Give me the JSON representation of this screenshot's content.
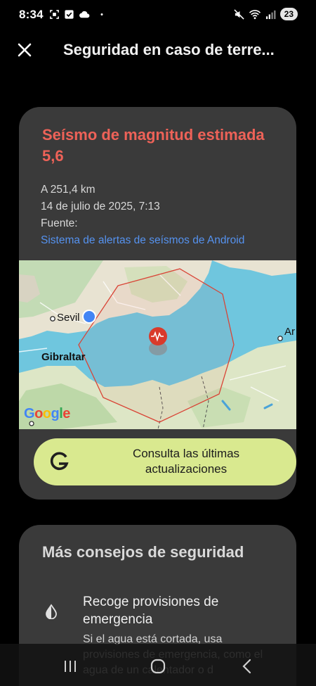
{
  "status_bar": {
    "time": "8:34",
    "battery": "23",
    "left_icons": [
      "screenshot-icon",
      "checkbox-icon",
      "cloud-icon",
      "dot-icon"
    ],
    "right_icons": [
      "mute-icon",
      "wifi-icon",
      "signal-icon"
    ]
  },
  "app_bar": {
    "title": "Seguridad en caso de terre..."
  },
  "quake_card": {
    "title": "Seísmo de magnitud estimada 5,6",
    "distance": "A 251,4 km",
    "datetime": "14 de julio de 2025, 7:13",
    "source_label": "Fuente:",
    "source_link": "Sistema de alertas de seísmos de Android",
    "colors": {
      "title": "#ee6258",
      "link": "#5592ef",
      "button": "#d9e98f"
    },
    "map": {
      "labels": {
        "sevilla": "Sevil",
        "gibraltar": "Gibraltar",
        "right_city": "Ar"
      },
      "google_logo": "Google"
    },
    "update_button": "Consulta las últimas actualizaciones"
  },
  "tips_card": {
    "title": "Más consejos de seguridad",
    "tip_title": "Recoge provisiones de emergencia",
    "tip_body": "Si el agua está cortada, usa provisiones de emergencia, como el agua de un calentador o d"
  },
  "nav_bar": {
    "icons": [
      "recents-icon",
      "home-icon",
      "back-icon"
    ]
  }
}
